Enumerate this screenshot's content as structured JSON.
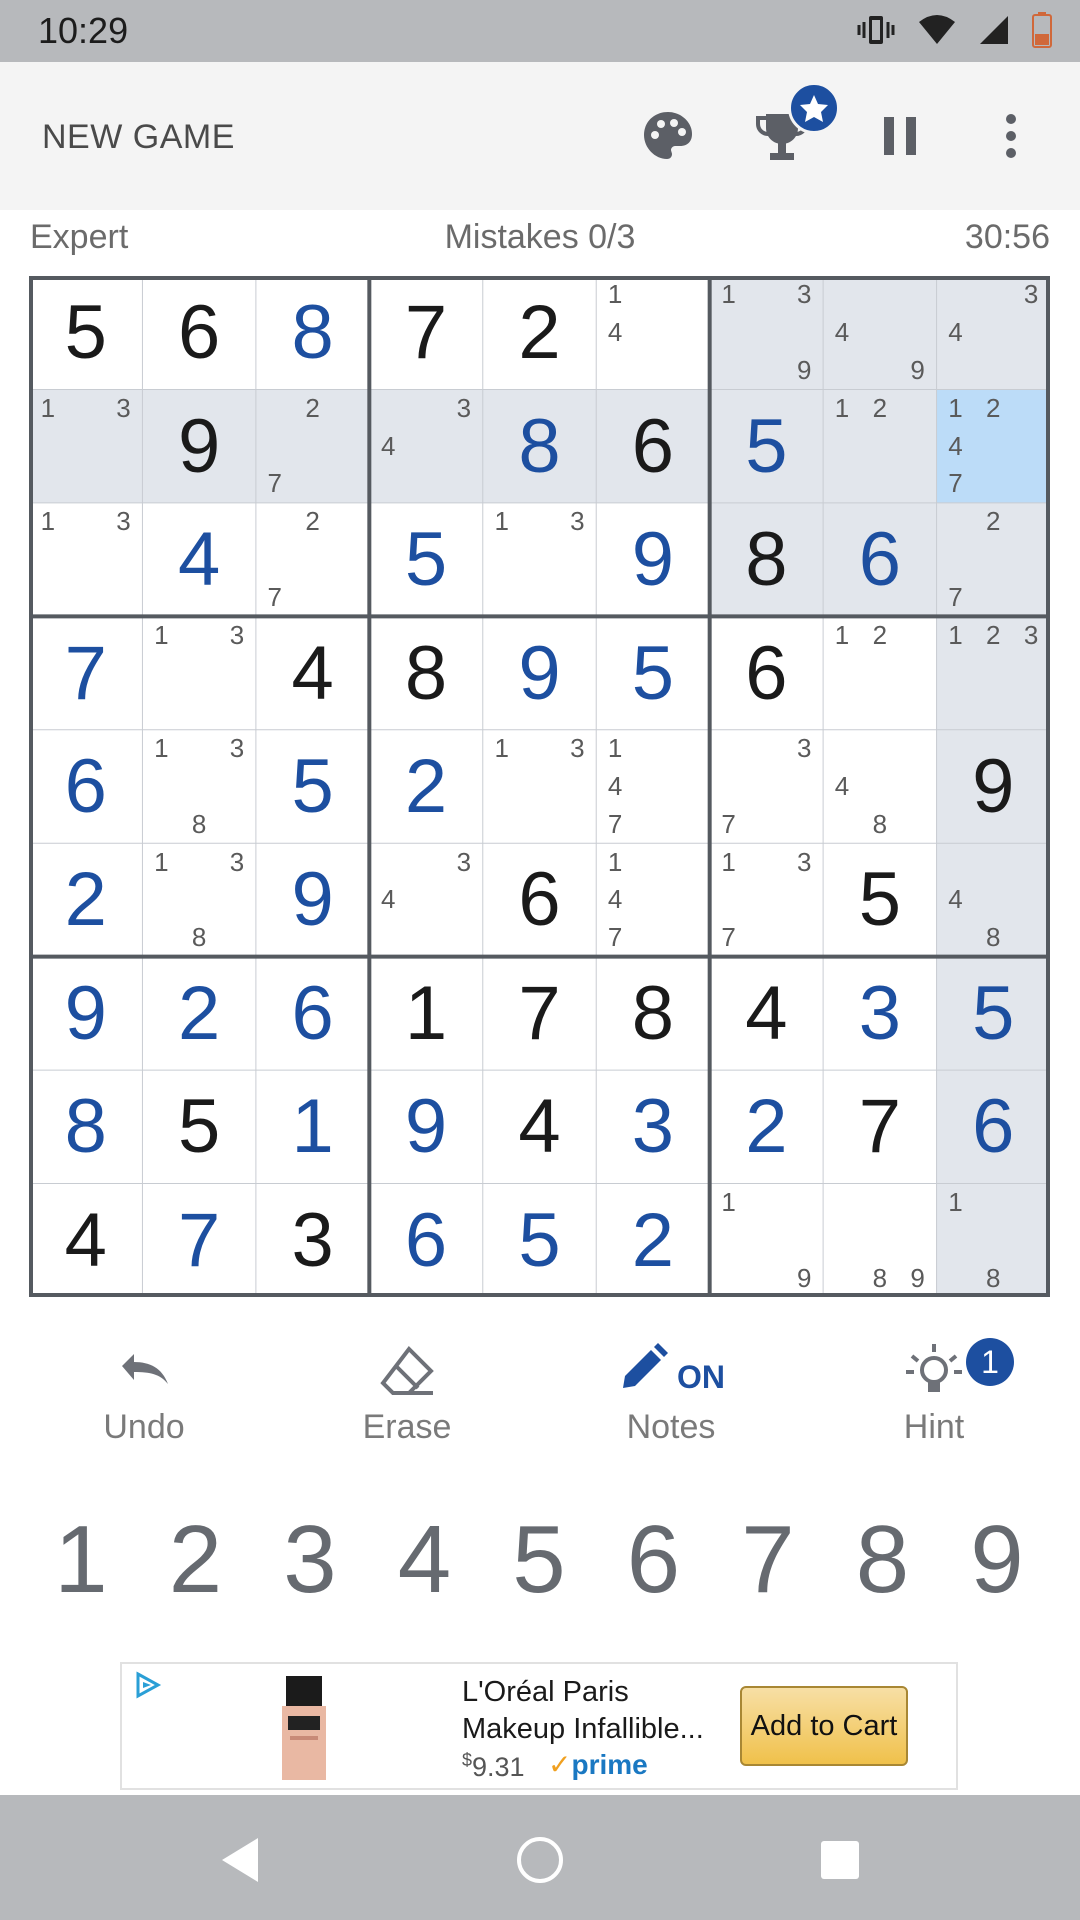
{
  "status_bar": {
    "time": "10:29"
  },
  "toolbar": {
    "new_game_label": "NEW GAME"
  },
  "game_info": {
    "difficulty": "Expert",
    "mistakes": "Mistakes 0/3",
    "timer": "30:56"
  },
  "board": {
    "selected": [
      1,
      8
    ],
    "cells": [
      [
        {
          "v": "5",
          "g": true
        },
        {
          "v": "6",
          "g": true
        },
        {
          "v": "8",
          "g": false
        },
        {
          "v": "7",
          "g": true
        },
        {
          "v": "2",
          "g": true
        },
        {
          "n": [
            "1",
            "",
            "",
            "4",
            "",
            "",
            "",
            "",
            ""
          ]
        },
        {
          "n": [
            "1",
            "",
            "3",
            "",
            "",
            "",
            "",
            "",
            "9"
          ]
        },
        {
          "n": [
            "",
            "",
            "",
            "4",
            "",
            "",
            "",
            "",
            "9"
          ]
        },
        {
          "n": [
            "",
            "",
            "3",
            "4",
            "",
            "",
            "",
            "",
            ""
          ]
        }
      ],
      [
        {
          "n": [
            "1",
            "",
            "3",
            "",
            "",
            "",
            "",
            "",
            ""
          ]
        },
        {
          "v": "9",
          "g": true
        },
        {
          "n": [
            "",
            "2",
            "",
            "",
            "",
            "",
            "7",
            "",
            ""
          ]
        },
        {
          "n": [
            "",
            "",
            "3",
            "4",
            "",
            "",
            "",
            "",
            ""
          ]
        },
        {
          "v": "8",
          "g": false
        },
        {
          "v": "6",
          "g": true
        },
        {
          "v": "5",
          "g": false
        },
        {
          "n": [
            "1",
            "2",
            "",
            "",
            "",
            "",
            "",
            "",
            ""
          ]
        },
        {
          "n": [
            "1",
            "2",
            "",
            "4",
            "",
            "",
            "7",
            "",
            ""
          ]
        }
      ],
      [
        {
          "n": [
            "1",
            "",
            "3",
            "",
            "",
            "",
            "",
            "",
            ""
          ]
        },
        {
          "v": "4",
          "g": false
        },
        {
          "n": [
            "",
            "2",
            "",
            "",
            "",
            "",
            "7",
            "",
            ""
          ]
        },
        {
          "v": "5",
          "g": false
        },
        {
          "n": [
            "1",
            "",
            "3",
            "",
            "",
            "",
            "",
            "",
            ""
          ]
        },
        {
          "v": "9",
          "g": false
        },
        {
          "v": "8",
          "g": true
        },
        {
          "v": "6",
          "g": false
        },
        {
          "n": [
            "",
            "2",
            "",
            "",
            "",
            "",
            "7",
            "",
            ""
          ]
        }
      ],
      [
        {
          "v": "7",
          "g": false
        },
        {
          "n": [
            "1",
            "",
            "3",
            "",
            "",
            "",
            "",
            "",
            ""
          ]
        },
        {
          "v": "4",
          "g": true
        },
        {
          "v": "8",
          "g": true
        },
        {
          "v": "9",
          "g": false
        },
        {
          "v": "5",
          "g": false
        },
        {
          "v": "6",
          "g": true
        },
        {
          "n": [
            "1",
            "2",
            "",
            "",
            "",
            "",
            "",
            "",
            ""
          ]
        },
        {
          "n": [
            "1",
            "2",
            "3",
            "",
            "",
            "",
            "",
            "",
            ""
          ]
        }
      ],
      [
        {
          "v": "6",
          "g": false
        },
        {
          "n": [
            "1",
            "",
            "3",
            "",
            "",
            "",
            "",
            "8",
            ""
          ]
        },
        {
          "v": "5",
          "g": false
        },
        {
          "v": "2",
          "g": false
        },
        {
          "n": [
            "1",
            "",
            "3",
            "",
            "",
            "",
            "",
            "",
            ""
          ]
        },
        {
          "n": [
            "1",
            "",
            "",
            "4",
            "",
            "",
            "7",
            "",
            ""
          ]
        },
        {
          "n": [
            "",
            "",
            "3",
            "",
            "",
            "",
            "7",
            "",
            ""
          ]
        },
        {
          "n": [
            "",
            "",
            "",
            "4",
            "",
            "",
            "",
            "8",
            ""
          ]
        },
        {
          "v": "9",
          "g": true
        }
      ],
      [
        {
          "v": "2",
          "g": false
        },
        {
          "n": [
            "1",
            "",
            "3",
            "",
            "",
            "",
            "",
            "8",
            ""
          ]
        },
        {
          "v": "9",
          "g": false
        },
        {
          "n": [
            "",
            "",
            "3",
            "4",
            "",
            "",
            "",
            "",
            ""
          ]
        },
        {
          "v": "6",
          "g": true
        },
        {
          "n": [
            "1",
            "",
            "",
            "4",
            "",
            "",
            "7",
            "",
            ""
          ]
        },
        {
          "n": [
            "1",
            "",
            "3",
            "",
            "",
            "",
            "7",
            "",
            ""
          ]
        },
        {
          "v": "5",
          "g": true
        },
        {
          "n": [
            "",
            "",
            "",
            "4",
            "",
            "",
            "",
            "8",
            ""
          ]
        }
      ],
      [
        {
          "v": "9",
          "g": false
        },
        {
          "v": "2",
          "g": false
        },
        {
          "v": "6",
          "g": false
        },
        {
          "v": "1",
          "g": true
        },
        {
          "v": "7",
          "g": true
        },
        {
          "v": "8",
          "g": true
        },
        {
          "v": "4",
          "g": true
        },
        {
          "v": "3",
          "g": false
        },
        {
          "v": "5",
          "g": false
        }
      ],
      [
        {
          "v": "8",
          "g": false
        },
        {
          "v": "5",
          "g": true
        },
        {
          "v": "1",
          "g": false
        },
        {
          "v": "9",
          "g": false
        },
        {
          "v": "4",
          "g": true
        },
        {
          "v": "3",
          "g": false
        },
        {
          "v": "2",
          "g": false
        },
        {
          "v": "7",
          "g": true
        },
        {
          "v": "6",
          "g": false
        }
      ],
      [
        {
          "v": "4",
          "g": true
        },
        {
          "v": "7",
          "g": false
        },
        {
          "v": "3",
          "g": true
        },
        {
          "v": "6",
          "g": false
        },
        {
          "v": "5",
          "g": false
        },
        {
          "v": "2",
          "g": false
        },
        {
          "n": [
            "1",
            "",
            "",
            "",
            "",
            "",
            "",
            "",
            "9"
          ]
        },
        {
          "n": [
            "",
            "",
            "",
            "",
            "",
            "",
            "",
            "8",
            "9"
          ]
        },
        {
          "n": [
            "1",
            "",
            "",
            "",
            "",
            "",
            "",
            "8",
            ""
          ]
        }
      ]
    ]
  },
  "colors": {
    "given": "#1a1a1a",
    "user": "#1d4fa0",
    "highlight": "#e2e6ec",
    "selected": "#bcdcf8",
    "accent": "#1d4fa0"
  },
  "controls": {
    "undo": "Undo",
    "erase": "Erase",
    "notes": "Notes",
    "notes_state": "ON",
    "hint": "Hint",
    "hint_count": "1"
  },
  "numpad": [
    "1",
    "2",
    "3",
    "4",
    "5",
    "6",
    "7",
    "8",
    "9"
  ],
  "ad": {
    "title": "L'Oréal Paris Makeup Infallible...",
    "price_symbol": "$",
    "price": "9.31",
    "prime": "prime",
    "cta": "Add to Cart"
  }
}
